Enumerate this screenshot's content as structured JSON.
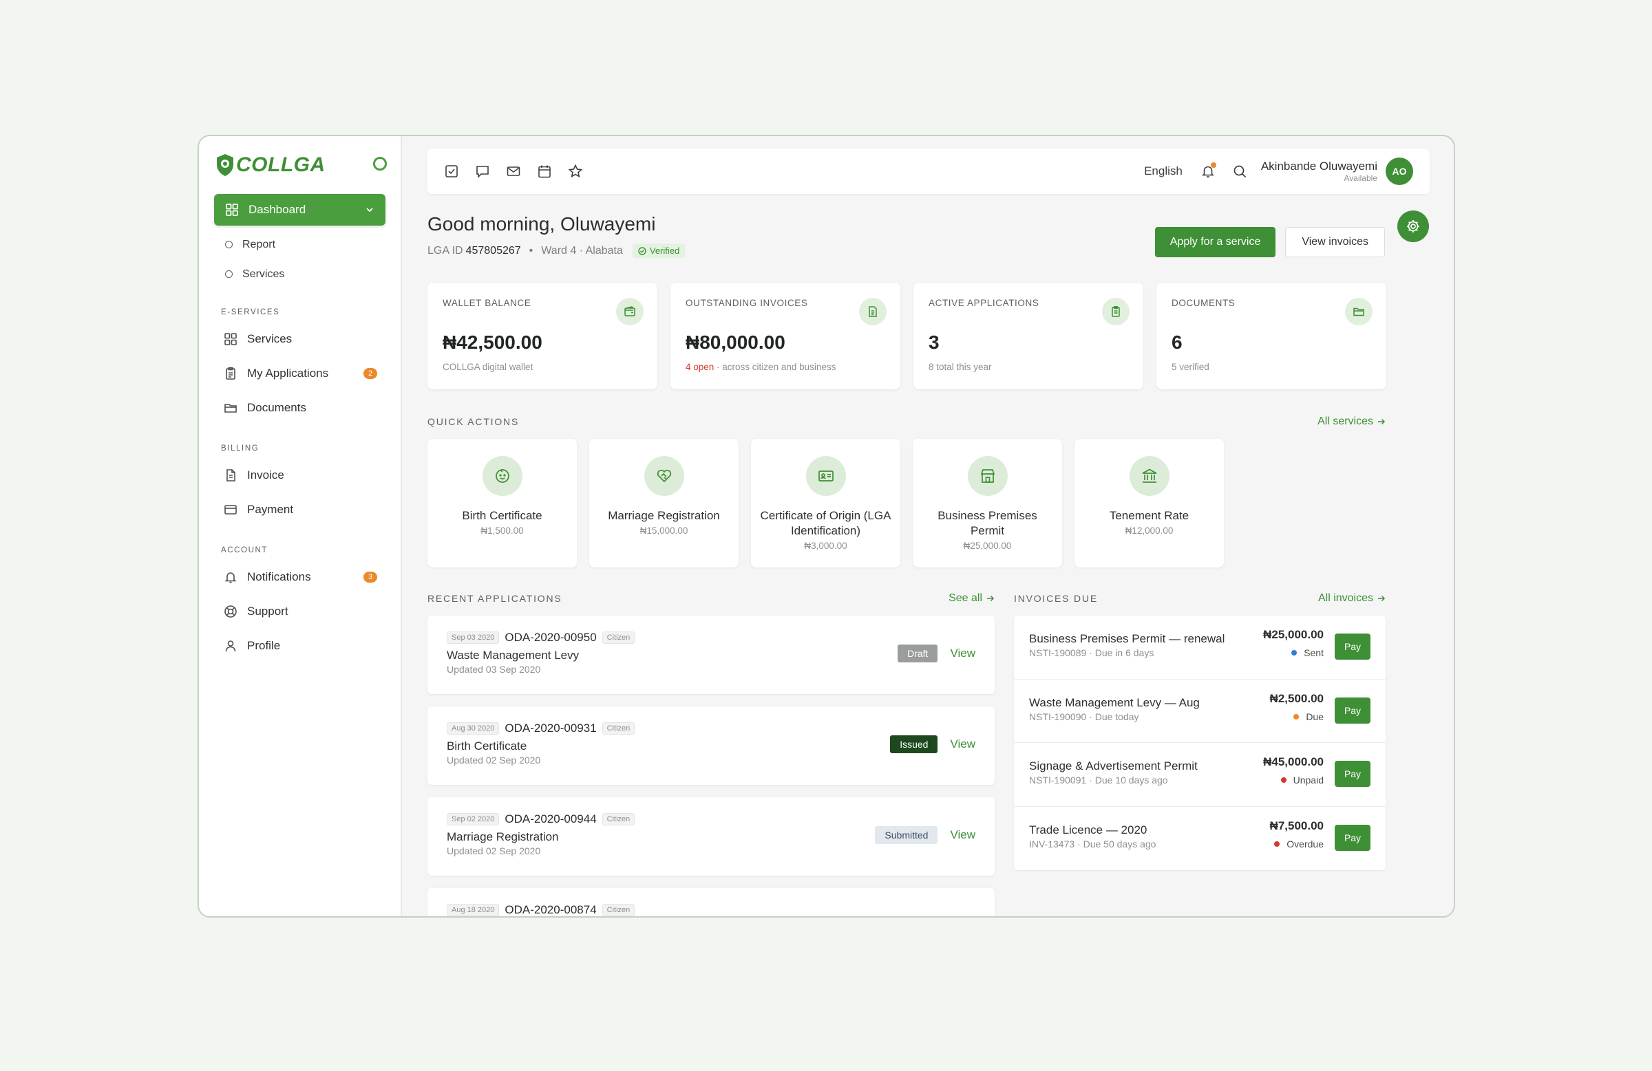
{
  "brand": {
    "name": "COLLGA"
  },
  "sidebar": {
    "dashboard_label": "Dashboard",
    "dashboard_sub": [
      {
        "label": "Report"
      },
      {
        "label": "Services"
      }
    ],
    "sections": [
      {
        "title": "E-SERVICES",
        "items": [
          {
            "label": "Services",
            "icon": "grid-icon",
            "badge": ""
          },
          {
            "label": "My Applications",
            "icon": "clipboard-icon",
            "badge": "2"
          },
          {
            "label": "Documents",
            "icon": "folder-icon",
            "badge": ""
          }
        ]
      },
      {
        "title": "BILLING",
        "items": [
          {
            "label": "Invoice",
            "icon": "file-text-icon",
            "badge": ""
          },
          {
            "label": "Payment",
            "icon": "credit-card-icon",
            "badge": ""
          }
        ]
      },
      {
        "title": "ACCOUNT",
        "items": [
          {
            "label": "Notifications",
            "icon": "bell-icon",
            "badge": "3"
          },
          {
            "label": "Support",
            "icon": "lifebuoy-icon",
            "badge": ""
          },
          {
            "label": "Profile",
            "icon": "user-icon",
            "badge": ""
          }
        ]
      }
    ]
  },
  "topbar": {
    "language": "English",
    "user_name": "Akinbande Oluwayemi",
    "user_status": "Available",
    "avatar_initials": "AO"
  },
  "header": {
    "greeting": "Good morning, Oluwayemi",
    "lga_id_label": "LGA ID",
    "lga_id": "457805267",
    "ward": "Ward 4 · Alabata",
    "verified": "Verified",
    "apply_button": "Apply for a service",
    "view_invoices_button": "View invoices"
  },
  "stats": [
    {
      "label": "WALLET BALANCE",
      "value": "₦42,500.00",
      "sub_highlight": "",
      "sub": "COLLGA digital wallet",
      "icon": "wallet-icon"
    },
    {
      "label": "OUTSTANDING INVOICES",
      "value": "₦80,000.00",
      "sub_highlight": "4 open",
      "sub": " · across citizen and business",
      "icon": "file-text-icon"
    },
    {
      "label": "ACTIVE APPLICATIONS",
      "value": "3",
      "sub_highlight": "",
      "sub": "8 total this year",
      "icon": "clipboard-icon"
    },
    {
      "label": "DOCUMENTS",
      "value": "6",
      "sub_highlight": "",
      "sub": "5 verified",
      "icon": "folder-icon"
    }
  ],
  "quick_actions": {
    "title": "QUICK ACTIONS",
    "link": "All services",
    "items": [
      {
        "name": "Birth Certificate",
        "price": "₦1,500.00",
        "icon": "baby-icon"
      },
      {
        "name": "Marriage Registration",
        "price": "₦15,000.00",
        "icon": "heart-handshake-icon"
      },
      {
        "name": "Certificate of Origin (LGA Identification)",
        "price": "₦3,000.00",
        "icon": "id-card-icon"
      },
      {
        "name": "Business Premises Permit",
        "price": "₦25,000.00",
        "icon": "store-icon"
      },
      {
        "name": "Tenement Rate",
        "price": "₦12,000.00",
        "icon": "bank-icon"
      }
    ]
  },
  "recent_applications": {
    "title": "RECENT APPLICATIONS",
    "link": "See all",
    "items": [
      {
        "date": "Sep 03 2020",
        "id": "ODA-2020-00950",
        "type": "Citizen",
        "title": "Waste Management Levy",
        "updated": "Updated 03 Sep 2020",
        "status": "Draft",
        "action": "View"
      },
      {
        "date": "Aug 30 2020",
        "id": "ODA-2020-00931",
        "type": "Citizen",
        "title": "Birth Certificate",
        "updated": "Updated 02 Sep 2020",
        "status": "Issued",
        "action": "View"
      },
      {
        "date": "Sep 02 2020",
        "id": "ODA-2020-00944",
        "type": "Citizen",
        "title": "Marriage Registration",
        "updated": "Updated 02 Sep 2020",
        "status": "Submitted",
        "action": "View"
      },
      {
        "date": "Aug 18 2020",
        "id": "ODA-2020-00874",
        "type": "Citizen",
        "title": "",
        "updated": "",
        "status": "",
        "action": ""
      }
    ]
  },
  "invoices_due": {
    "title": "INVOICES DUE",
    "link": "All invoices",
    "items": [
      {
        "title": "Business Premises Permit — renewal",
        "ref": "NSTI-190089 · Due in 6 days",
        "amount": "₦25,000.00",
        "status": "Sent",
        "status_color": "#2f7fd6",
        "action": "Pay"
      },
      {
        "title": "Waste Management Levy — Aug",
        "ref": "NSTI-190090 · Due today",
        "amount": "₦2,500.00",
        "status": "Due",
        "status_color": "#e98a2b",
        "action": "Pay"
      },
      {
        "title": "Signage & Advertisement Permit",
        "ref": "NSTI-190091 · Due 10 days ago",
        "amount": "₦45,000.00",
        "status": "Unpaid",
        "status_color": "#d33a2c",
        "action": "Pay"
      },
      {
        "title": "Trade Licence — 2020",
        "ref": "INV-13473 · Due 50 days ago",
        "amount": "₦7,500.00",
        "status": "Overdue",
        "status_color": "#d33a2c",
        "action": "Pay"
      }
    ]
  },
  "colors": {
    "primary": "#3e8f35",
    "sidebar_active": "#4a9e3e",
    "badge": "#e98a2b"
  }
}
